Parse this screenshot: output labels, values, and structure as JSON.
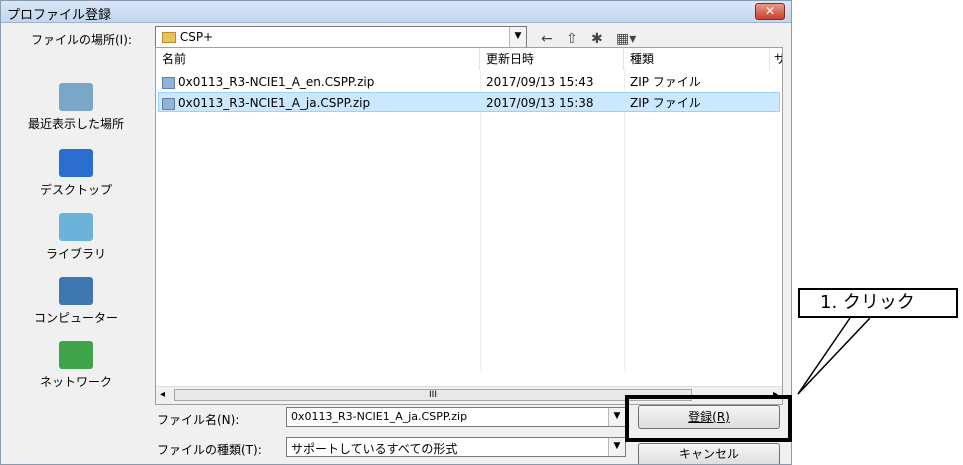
{
  "window": {
    "title": "プロファイル登録",
    "close_glyph": "✕"
  },
  "look_in": {
    "label": "ファイルの場所(I):",
    "value": "CSP+"
  },
  "places": [
    {
      "name": "recent",
      "label": "最近表示した場所",
      "icon": "recent-places-icon"
    },
    {
      "name": "desktop",
      "label": "デスクトップ",
      "icon": "desktop-icon"
    },
    {
      "name": "library",
      "label": "ライブラリ",
      "icon": "library-icon"
    },
    {
      "name": "computer",
      "label": "コンピューター",
      "icon": "computer-icon"
    },
    {
      "name": "network",
      "label": "ネットワーク",
      "icon": "network-icon"
    }
  ],
  "columns": [
    {
      "label": "名前"
    },
    {
      "label": "更新日時"
    },
    {
      "label": "種類"
    },
    {
      "label": "サ"
    }
  ],
  "files": [
    {
      "name": "0x0113_R3-NCIE1_A_en.CSPP.zip",
      "date": "2017/09/13 15:43",
      "type": "ZIP ファイル",
      "selected": false
    },
    {
      "name": "0x0113_R3-NCIE1_A_ja.CSPP.zip",
      "date": "2017/09/13 15:38",
      "type": "ZIP ファイル",
      "selected": true
    }
  ],
  "scroll": {
    "thumb_grip": "III",
    "left_arrow": "◂",
    "right_arrow": "▸"
  },
  "filename": {
    "label": "ファイル名(N):",
    "value": "0x0113_R3-NCIE1_A_ja.CSPP.zip"
  },
  "filetype": {
    "label": "ファイルの種類(T):",
    "value": "サポートしているすべての形式"
  },
  "buttons": {
    "register": "登録(R)",
    "cancel": "キャンセル"
  },
  "annotation": {
    "text": "1. クリック"
  },
  "colors": {
    "selection": "#cce8ff",
    "title_gradient_top": "#d9e7f7",
    "close": "#c8412b"
  }
}
